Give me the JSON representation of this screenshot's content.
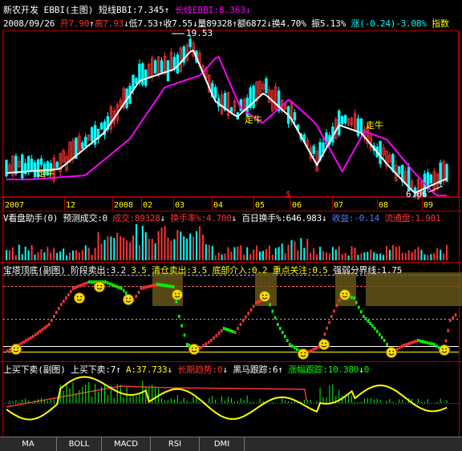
{
  "main_panel": {
    "title_stock": "新农开发",
    "title_indicator": "EBBI(主图)",
    "short_label": "短线BBI:7.345",
    "short_arrow": "↑",
    "long_label": "长线EBBI:8.363",
    "long_arrow": "↓",
    "date": "2008/09/26",
    "open": "开7.90",
    "open_arrow": "↑",
    "high": "高7.93",
    "high_arrow": "↓",
    "low": "低7.53",
    "low_arrow": "↑",
    "close": "收7.55",
    "close_arrow": "↓",
    "volume": "量89328",
    "volume_arrow": "↑",
    "amount": "额6872",
    "amount_arrow": "↓",
    "turnover": "换4.70%",
    "amplitude": "振5.13%",
    "change": "涨(-0.24)-3.08%",
    "extra": "指数",
    "high_marker": "19.53",
    "low_marker": "6.06",
    "annotations": [
      "走牛",
      "走牛",
      "走牛"
    ],
    "timeline": [
      "2007",
      "12",
      "2008",
      "02",
      "03",
      "04",
      "05",
      "06",
      "07",
      "08",
      "09"
    ],
    "dollar_marker": "$"
  },
  "volume_panel": {
    "title": "V看盘助手(0) 预测成交:0",
    "trade_label": "成交:89328",
    "trade_arrow": "↓",
    "turnover_label": "换手率%:4.700",
    "turnover_arrow": "↓",
    "hundred_label": "百日换手%:646.983",
    "hundred_arrow": "↓",
    "profit_label": "收益:-0.14",
    "float_label": "流通盘:1.901"
  },
  "tower_panel": {
    "title": "宝塔顶底(副图) 阶段卖出:3.2",
    "clear_label": "3.5 清仓卖出:3.5",
    "bottom_label": "底部介入:0.2",
    "focus_label": "重点关注:0.5",
    "strong_label": "强弱分界线:1.75"
  },
  "updown_panel": {
    "title": "上买下卖(副图)",
    "trade_label": "上买下卖:7",
    "trade_arrow": "↑",
    "a_label": "A:37.733",
    "a_arrow": "↓",
    "long_trend": "长期趋势:0",
    "long_arrow": "↓",
    "horse_label": "黑马跟踪:6",
    "horse_arrow": "↑",
    "rise_label": "涨幅跟踪:10.380",
    "rise_arrow": "↓",
    "rise_tail": "0"
  },
  "tabs": [
    "MA",
    "BOLL",
    "MACD",
    "RSI",
    "DMI"
  ],
  "colors": {
    "white": "#ffffff",
    "magenta": "#ff00ff",
    "red": "#ff3232",
    "cyan": "#00ffff",
    "yellow": "#ffff00",
    "green": "#00ff00",
    "blue": "#4e7cff",
    "grid_red": "#aa0000"
  }
}
